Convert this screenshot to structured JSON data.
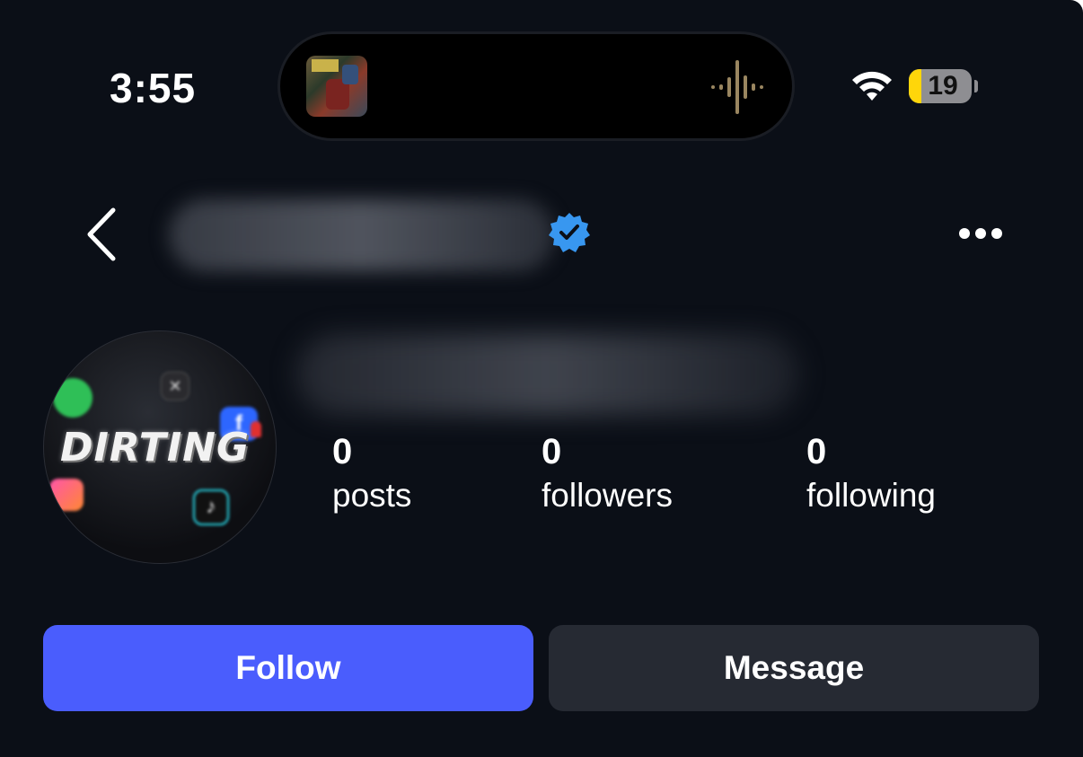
{
  "status_bar": {
    "time": "3:55",
    "battery_level": "19",
    "now_playing_art": "album-art",
    "icons": [
      "audio-waveform-icon",
      "wifi-icon",
      "battery-icon"
    ]
  },
  "header": {
    "back_icon": "chevron-left-icon",
    "verified_icon": "verified-badge-icon",
    "more_icon": "more-options-icon"
  },
  "profile": {
    "avatar_logo": "DIRTING",
    "stats": [
      {
        "value": "0",
        "label": "posts"
      },
      {
        "value": "0",
        "label": "followers"
      },
      {
        "value": "0",
        "label": "following"
      }
    ]
  },
  "actions": {
    "follow_label": "Follow",
    "message_label": "Message"
  },
  "colors": {
    "background": "#0b0f17",
    "follow_button": "#4a5dfd",
    "message_button": "#262a33",
    "verified": "#3897f0",
    "battery_low": "#ffd60a"
  }
}
